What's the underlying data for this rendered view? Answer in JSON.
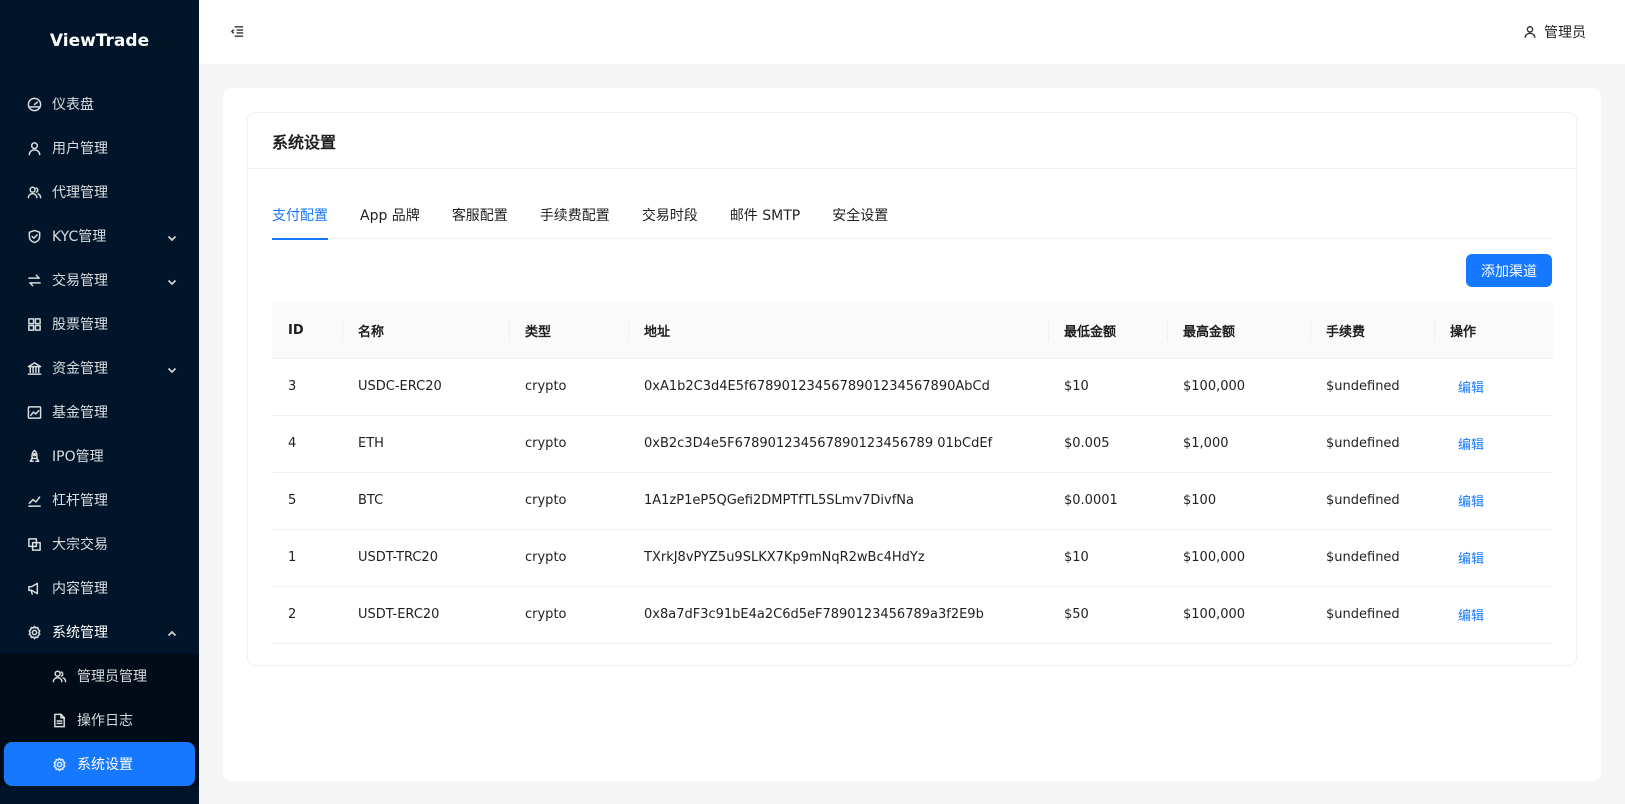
{
  "app": {
    "logo": "ViewTrade"
  },
  "sidebar": {
    "items": [
      {
        "label": "仪表盘",
        "icon": "dashboard-icon"
      },
      {
        "label": "用户管理",
        "icon": "user-icon"
      },
      {
        "label": "代理管理",
        "icon": "team-icon"
      },
      {
        "label": "KYC管理",
        "icon": "shield-icon",
        "expandable": true
      },
      {
        "label": "交易管理",
        "icon": "swap-icon",
        "expandable": true
      },
      {
        "label": "股票管理",
        "icon": "grid-icon"
      },
      {
        "label": "资金管理",
        "icon": "bank-icon",
        "expandable": true
      },
      {
        "label": "基金管理",
        "icon": "fund-icon"
      },
      {
        "label": "IPO管理",
        "icon": "rocket-icon"
      },
      {
        "label": "杠杆管理",
        "icon": "stock-icon"
      },
      {
        "label": "大宗交易",
        "icon": "block-icon"
      },
      {
        "label": "内容管理",
        "icon": "notification-icon"
      },
      {
        "label": "系统管理",
        "icon": "setting-icon",
        "expanded": true
      }
    ],
    "submenu": [
      {
        "label": "管理员管理",
        "icon": "team-icon"
      },
      {
        "label": "操作日志",
        "icon": "file-icon"
      },
      {
        "label": "系统设置",
        "icon": "setting-icon",
        "active": true
      }
    ]
  },
  "header": {
    "user": "管理员"
  },
  "page": {
    "title": "系统设置",
    "tabs": [
      "支付配置",
      "App 品牌",
      "客服配置",
      "手续费配置",
      "交易时段",
      "邮件 SMTP",
      "安全设置"
    ],
    "active_tab": "支付配置",
    "add_button": "添加渠道"
  },
  "table": {
    "columns": [
      "ID",
      "名称",
      "类型",
      "地址",
      "最低金额",
      "最高金额",
      "手续费",
      "操作"
    ],
    "rows": [
      [
        "3",
        "USDC-ERC20",
        "crypto",
        "0xA1b2C3d4E5f6789012345678901234567890AbCd",
        "$10",
        "$100,000",
        "$undefined",
        "编辑"
      ],
      [
        "4",
        "ETH",
        "crypto",
        "0xB2c3D4e5F678901234567890123456789 01bCdEf",
        "$0.005",
        "$1,000",
        "$undefined",
        "编辑"
      ],
      [
        "5",
        "BTC",
        "crypto",
        "1A1zP1eP5QGefi2DMPTfTL5SLmv7DivfNa",
        "$0.0001",
        "$100",
        "$undefined",
        "编辑"
      ],
      [
        "1",
        "USDT-TRC20",
        "crypto",
        "TXrkJ8vPYZ5u9SLKX7Kp9mNqR2wBc4HdYz",
        "$10",
        "$100,000",
        "$undefined",
        "编辑"
      ],
      [
        "2",
        "USDT-ERC20",
        "crypto",
        "0x8a7dF3c91bE4a2C6d5eF7890123456789a3f2E9b",
        "$50",
        "$100,000",
        "$undefined",
        "编辑"
      ]
    ]
  },
  "colors": {
    "sidebar_bg": "#001529",
    "submenu_bg": "#000c17",
    "primary": "#1677ff"
  }
}
